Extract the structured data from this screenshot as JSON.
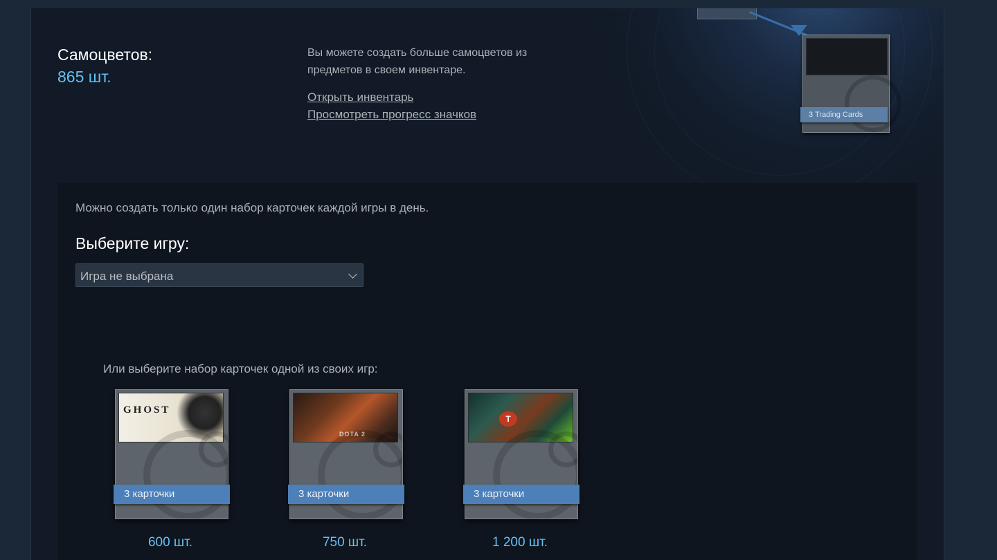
{
  "gems": {
    "title": "Самоцветов:",
    "count": "865 шт."
  },
  "info": {
    "description": "Вы можете создать больше самоцветов из предметов в своем инвентаре.",
    "open_inventory": "Открыть инвентарь",
    "badge_progress": "Просмотреть прогресс значков"
  },
  "promo_card": {
    "label": "3 Trading Cards"
  },
  "panel": {
    "note": "Можно создать только один набор карточек каждой игры в день.",
    "choose_label": "Выберите игру:",
    "select_value": "Игра не выбрана",
    "or_text": "Или выберите набор карточек одной из своих игр:"
  },
  "games": [
    {
      "art_text": "GHOST",
      "ribbon": "3 карточки",
      "price": "600 шт."
    },
    {
      "art_text": "DOTA 2",
      "ribbon": "3 карточки",
      "price": "750 шт."
    },
    {
      "art_text": "T",
      "ribbon": "3 карточки",
      "price": "1 200 шт."
    }
  ]
}
